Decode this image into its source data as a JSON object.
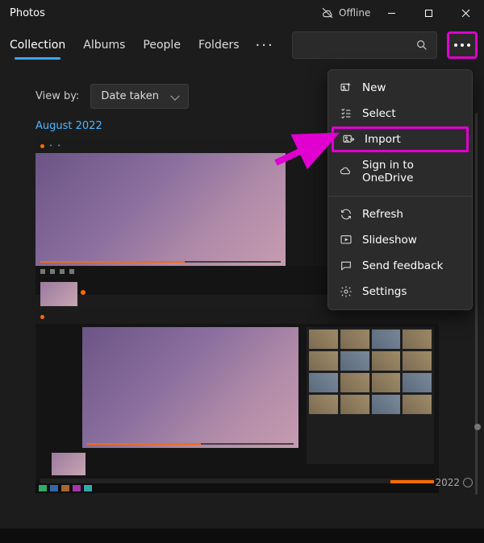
{
  "app": {
    "title": "Photos",
    "offline_label": "Offline"
  },
  "window_controls": {
    "minimize": "Minimize",
    "maximize": "Maximize",
    "close": "Close"
  },
  "tabs": {
    "items": [
      "Collection",
      "Albums",
      "People",
      "Folders"
    ],
    "active_index": 0
  },
  "search": {
    "placeholder": ""
  },
  "viewby": {
    "label": "View by:",
    "selected": "Date taken"
  },
  "section": {
    "date_heading": "August 2022"
  },
  "context_menu": {
    "items": [
      {
        "label": "New",
        "icon": "image-plus"
      },
      {
        "label": "Select",
        "icon": "checklist"
      },
      {
        "label": "Import",
        "icon": "image-import",
        "highlighted": true
      },
      {
        "label": "Sign in to OneDrive",
        "icon": "cloud"
      },
      {
        "sep": true
      },
      {
        "label": "Refresh",
        "icon": "refresh"
      },
      {
        "label": "Slideshow",
        "icon": "play-square"
      },
      {
        "label": "Send feedback",
        "icon": "chat"
      },
      {
        "label": "Settings",
        "icon": "gear"
      }
    ]
  },
  "timeline": {
    "year": "2022"
  },
  "highlight_color": "#e000d0",
  "accent_orange": "#ff6a00",
  "link_blue": "#4fb6ff"
}
